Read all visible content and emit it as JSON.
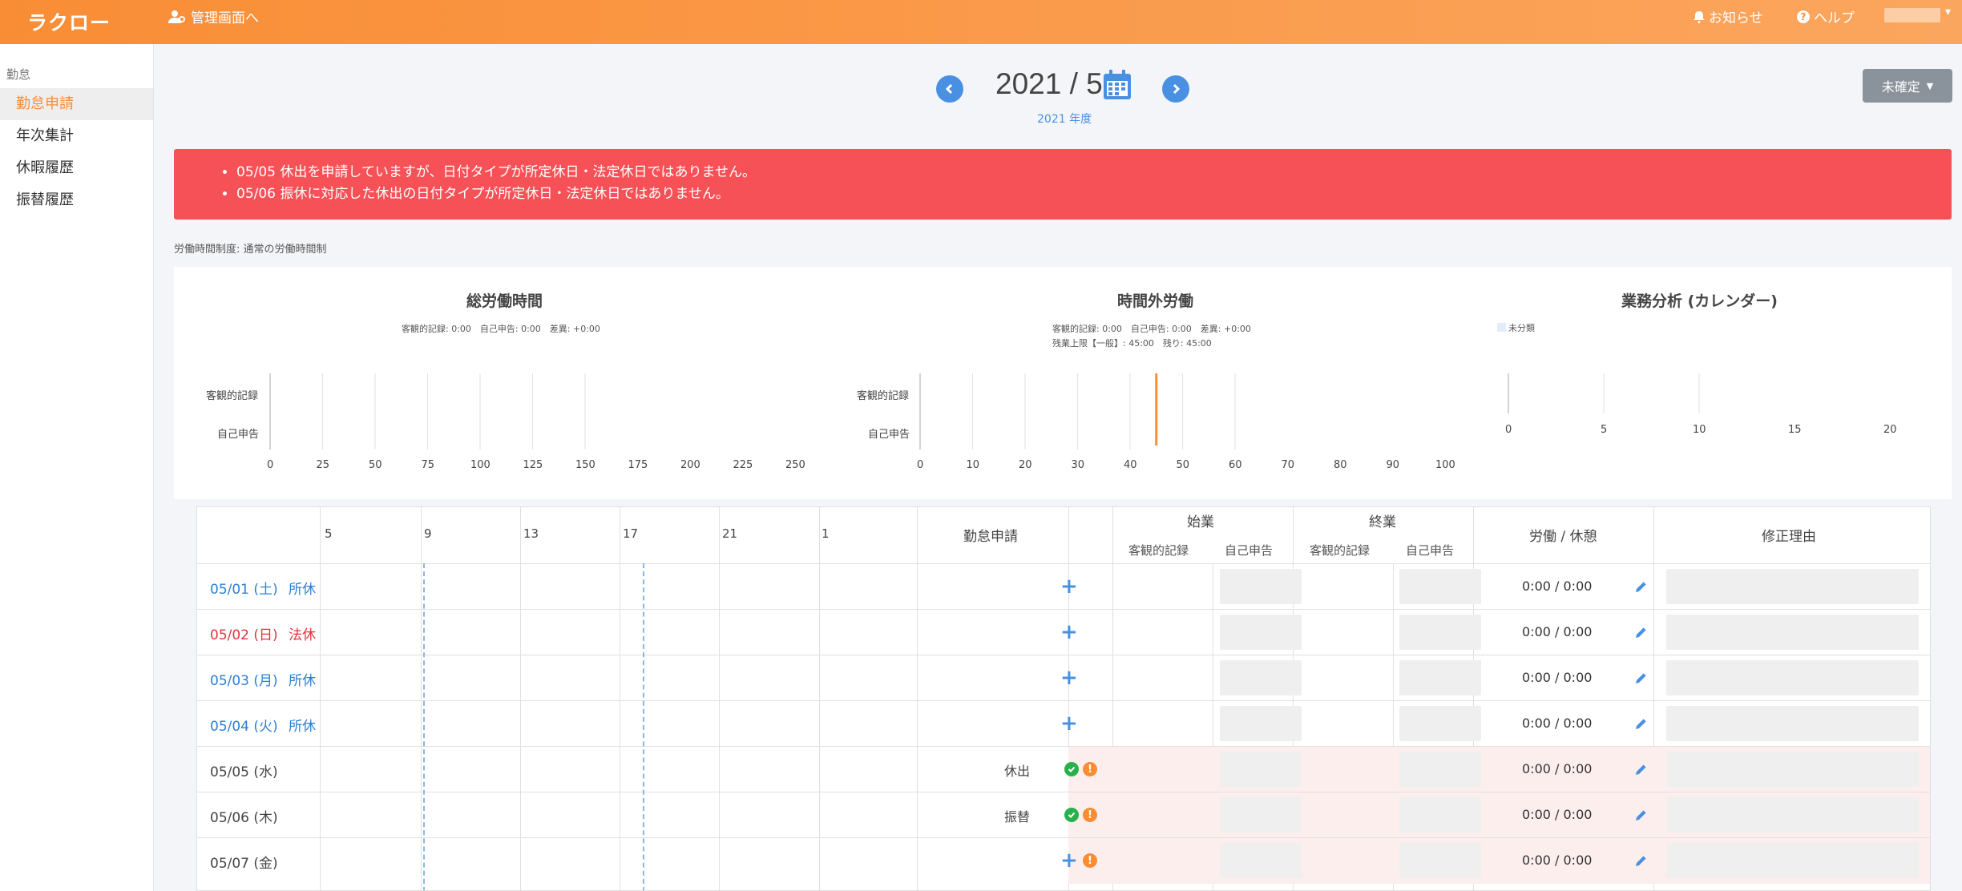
{
  "header": {
    "logo": "ラクロー",
    "admin_link": "管理画面へ",
    "notifications": "お知らせ",
    "help": "ヘルプ"
  },
  "sidebar": {
    "group": "勤怠",
    "items": [
      {
        "label": "勤怠申請",
        "active": true
      },
      {
        "label": "年次集計",
        "active": false
      },
      {
        "label": "休暇履歴",
        "active": false
      },
      {
        "label": "振替履歴",
        "active": false
      }
    ]
  },
  "month_nav": {
    "title": "2021 / 5",
    "fiscal_year": "2021 年度"
  },
  "status_button": "未確定",
  "alerts": [
    "05/05 休出を申請していますが、日付タイプが所定休日・法定休日ではありません。",
    "05/06 振休に対応した休出の日付タイプが所定休日・法定休日ではありません。"
  ],
  "system_label": "労働時間制度: 通常の労働時間制",
  "charts": {
    "total": {
      "title": "総労働時間",
      "summary": "客観的記録: 0:00　自己申告: 0:00　差異: +0:00",
      "row_labels": [
        "客観的記録",
        "自己申告"
      ],
      "ticks": [
        "0",
        "25",
        "50",
        "75",
        "100",
        "125",
        "150",
        "175",
        "200",
        "225",
        "250"
      ]
    },
    "overtime": {
      "title": "時間外労働",
      "summary": "客観的記録: 0:00　自己申告: 0:00　差異: +0:00",
      "summary2": "残業上限【一般】: 45:00　残り: 45:00",
      "row_labels": [
        "客観的記録",
        "自己申告"
      ],
      "ticks": [
        "0",
        "10",
        "20",
        "30",
        "40",
        "50",
        "60",
        "70",
        "80",
        "90",
        "100"
      ],
      "limit_line": 45
    },
    "analysis": {
      "title": "業務分析 (カレンダー)",
      "legend": "未分類",
      "ticks": [
        "0",
        "5",
        "10",
        "15",
        "20"
      ]
    }
  },
  "table": {
    "time_headers": [
      "5",
      "9",
      "13",
      "17",
      "21",
      "1"
    ],
    "col_request": "勤怠申請",
    "col_start": "始業",
    "col_end": "終業",
    "sub_objective": "客観的記録",
    "sub_self": "自己申告",
    "col_work": "労働 / 休憩",
    "col_reason": "修正理由",
    "rows": [
      {
        "date": "05/01 (土)",
        "type": "所休",
        "color": "#2b7fd6",
        "request": "",
        "work": "0:00 / 0:00",
        "warn": false
      },
      {
        "date": "05/02 (日)",
        "type": "法休",
        "color": "#e2323d",
        "request": "",
        "work": "0:00 / 0:00",
        "warn": false
      },
      {
        "date": "05/03 (月)",
        "type": "所休",
        "color": "#2b7fd6",
        "request": "",
        "work": "0:00 / 0:00",
        "warn": false
      },
      {
        "date": "05/04 (火)",
        "type": "所休",
        "color": "#2b7fd6",
        "request": "",
        "work": "0:00 / 0:00",
        "warn": false
      },
      {
        "date": "05/05 (水)",
        "type": "",
        "color": "#444444",
        "request": "休出",
        "work": "0:00 / 0:00",
        "warn": true
      },
      {
        "date": "05/06 (木)",
        "type": "",
        "color": "#444444",
        "request": "振替",
        "work": "0:00 / 0:00",
        "warn": true
      },
      {
        "date": "05/07 (金)",
        "type": "",
        "color": "#444444",
        "request": "",
        "work": "0:00 / 0:00",
        "warn": true
      }
    ]
  }
}
